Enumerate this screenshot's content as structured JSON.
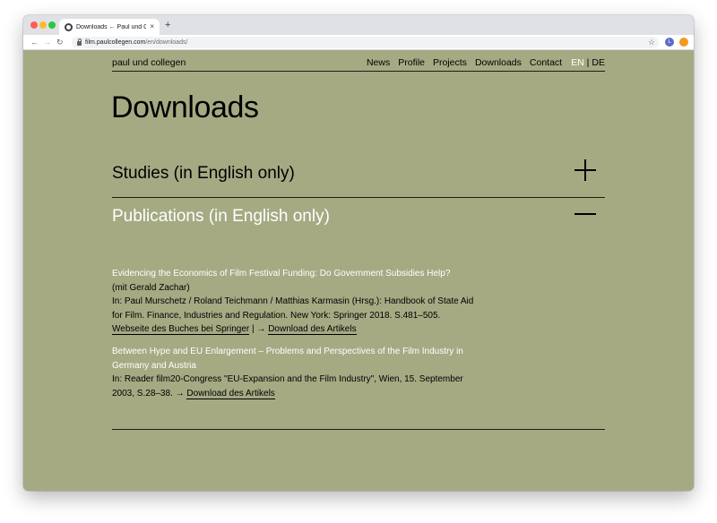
{
  "browser": {
    "tab_title": "Downloads ← Paul und Collegen",
    "tab_close": "×",
    "new_tab": "+",
    "url_host": "film.paulcollegen.com",
    "url_path": "/en/downloads/",
    "profile_initial": "L",
    "back_icon": "arrow-left-icon",
    "forward_icon": "arrow-right-icon",
    "reload_icon": "reload-icon",
    "star_icon": "star-icon"
  },
  "site": {
    "name": "paul und collegen",
    "nav": [
      "News",
      "Profile",
      "Projects",
      "Downloads",
      "Contact"
    ],
    "lang_en": "EN",
    "lang_sep": "|",
    "lang_de": "DE"
  },
  "page": {
    "title": "Downloads",
    "sections": [
      {
        "title": "Studies (in English only)",
        "state": "collapsed"
      },
      {
        "title": "Publications (in English only)",
        "state": "expanded"
      }
    ],
    "entries": [
      {
        "title": "Evidencing the Economics of Film Festival Funding: Do Government Subsidies Help?",
        "coauthor": "(mit Gerald Zachar)",
        "citation": "In: Paul Murschetz / Roland Teichmann / Matthias Karmasin (Hrsg.): Handbook of State Aid for Film. Finance, Industries and Regulation. New York: Springer 2018. S.481–505.",
        "link1": "Webseite des Buches bei Springer",
        "sep": " | → ",
        "link2": "Download des Artikels"
      },
      {
        "title": "Between Hype and EU Enlargement – Problems and Perspectives of the Film Industry in Germany and Austria",
        "citation": "In: Reader film20-Congress \"EU-Expansion and the Film Industry\", Wien, 15. September 2003, S.28–38. → ",
        "link": "Download des Artikels"
      }
    ]
  },
  "colors": {
    "page_bg": "#a5aa83",
    "highlight_text": "#ffffff",
    "body_text": "#000000"
  }
}
